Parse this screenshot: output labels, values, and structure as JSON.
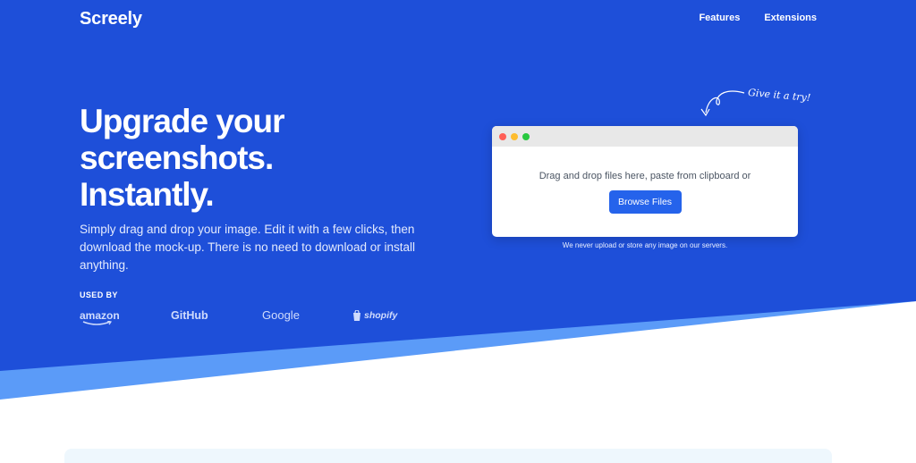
{
  "brand": {
    "name": "Screely"
  },
  "nav": {
    "items": [
      "Features",
      "Extensions"
    ]
  },
  "hero": {
    "headline_lines": [
      "Upgrade your",
      "screenshots.",
      "Instantly."
    ],
    "subtext": "Simply drag and drop your image. Edit it with a few clicks, then download the mock-up. There is no need to download or install anything."
  },
  "used_by": {
    "label": "USED BY",
    "logos": [
      "amazon",
      "GitHub",
      "Google",
      "shopify"
    ]
  },
  "uploader": {
    "handwritten_note": "Give it a try!",
    "drop_text": "Drag and drop files here, paste from clipboard or",
    "button_label": "Browse Files",
    "privacy_note": "We never upload or store any image on our servers."
  },
  "colors": {
    "hero_blue": "#1e4fd9",
    "accent_light_blue": "#5b9bf8",
    "button_blue": "#2563eb"
  }
}
